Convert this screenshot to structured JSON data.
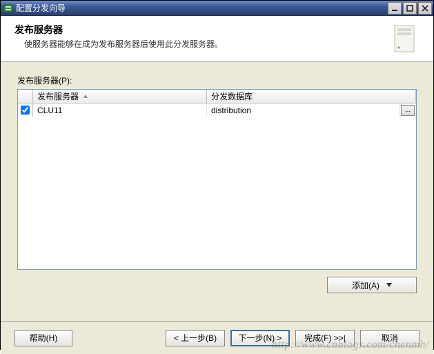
{
  "window": {
    "title": "配置分发向导"
  },
  "header": {
    "title": "发布服务器",
    "subtitle": "使服务器能够在成为发布服务器后使用此分发服务器。"
  },
  "body": {
    "list_label": "发布服务器(P):",
    "columns": {
      "server": "发布服务器",
      "db": "分发数据库"
    },
    "rows": [
      {
        "checked": true,
        "server": "CLU11",
        "db": "distribution"
      }
    ],
    "browse_label": "...",
    "add_label": "添加(A)"
  },
  "footer": {
    "help": "帮助(H)",
    "back": "< 上一步(B)",
    "next": "下一步(N) >",
    "finish": "完成(F) >>|",
    "cancel": "取消"
  },
  "watermark": "http://www.cnblogs.com/chenmh/"
}
